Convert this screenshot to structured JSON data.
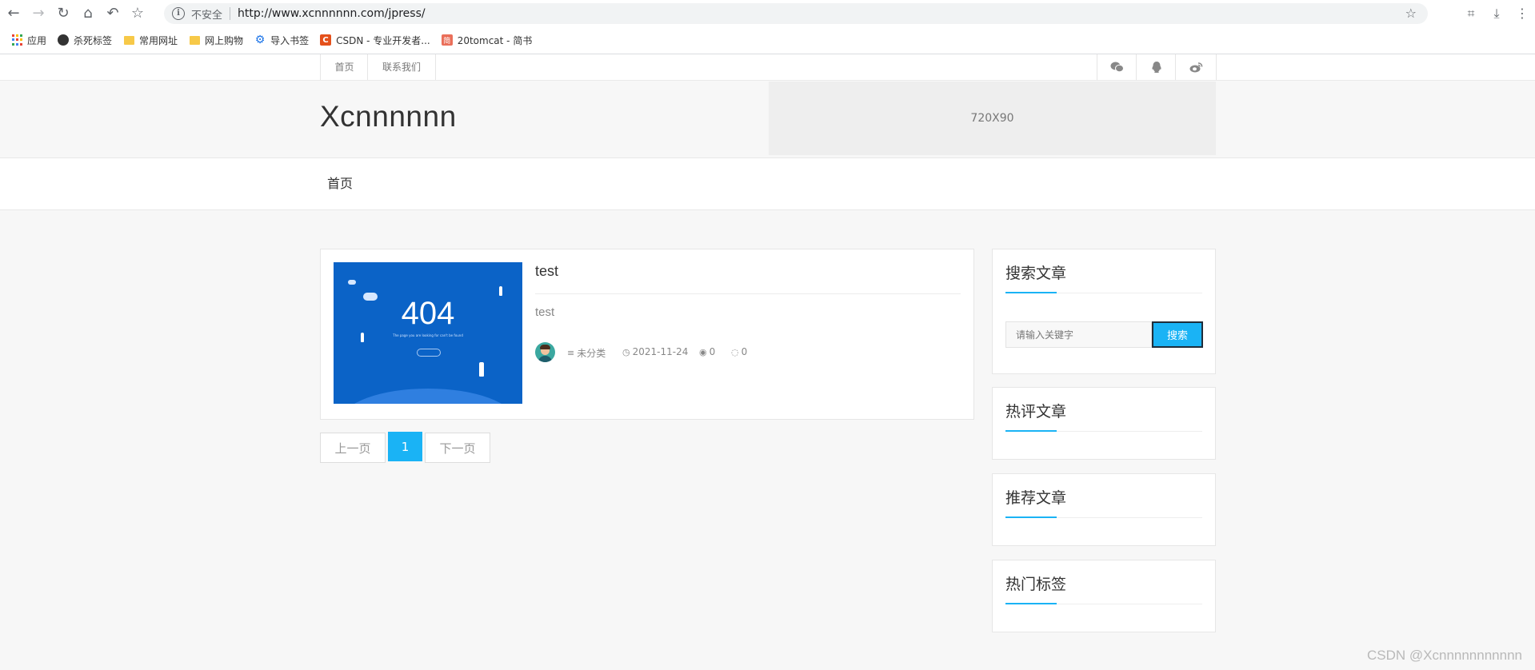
{
  "browser": {
    "security_label": "不安全",
    "url": "http://www.xcnnnnnn.com/jpress/",
    "bookmarks": [
      {
        "label": "应用",
        "icon": "apps-grid-icon"
      },
      {
        "label": "杀死标签",
        "icon": "globe-icon"
      },
      {
        "label": "常用网址",
        "icon": "folder-icon"
      },
      {
        "label": "网上购物",
        "icon": "folder-icon"
      },
      {
        "label": "导入书签",
        "icon": "gear-icon"
      },
      {
        "label": "CSDN - 专业开发者...",
        "icon": "csdn-logo-icon",
        "icon_text": "C"
      },
      {
        "label": "20tomcat - 简书",
        "icon": "jianshu-logo-icon",
        "icon_text": "简"
      }
    ]
  },
  "topbar": {
    "links": [
      "首页",
      "联系我们"
    ],
    "social_icons": [
      "wechat-icon",
      "qq-icon",
      "weibo-icon"
    ]
  },
  "header": {
    "site_title": "Xcnnnnnn",
    "ad_placeholder": "720X90"
  },
  "nav": {
    "items": [
      "首页"
    ]
  },
  "article": {
    "thumbnail_text": "404",
    "thumbnail_caption": "The page you are looking for can't be found",
    "title": "test",
    "summary": "test",
    "category": "未分类",
    "date": "2021-11-24",
    "views": "0",
    "comments": "0"
  },
  "pagination": {
    "prev": "上一页",
    "current": "1",
    "next": "下一页"
  },
  "sidebar": {
    "search_title": "搜索文章",
    "search_placeholder": "请输入关键字",
    "search_button": "搜索",
    "hot_comment_title": "热评文章",
    "recommended_title": "推荐文章",
    "hot_tags_title": "热门标签"
  },
  "watermark": "CSDN @Xcnnnnnnnnnnn",
  "colors": {
    "accent": "#1ab3f5",
    "page_bg": "#f7f7f7"
  }
}
